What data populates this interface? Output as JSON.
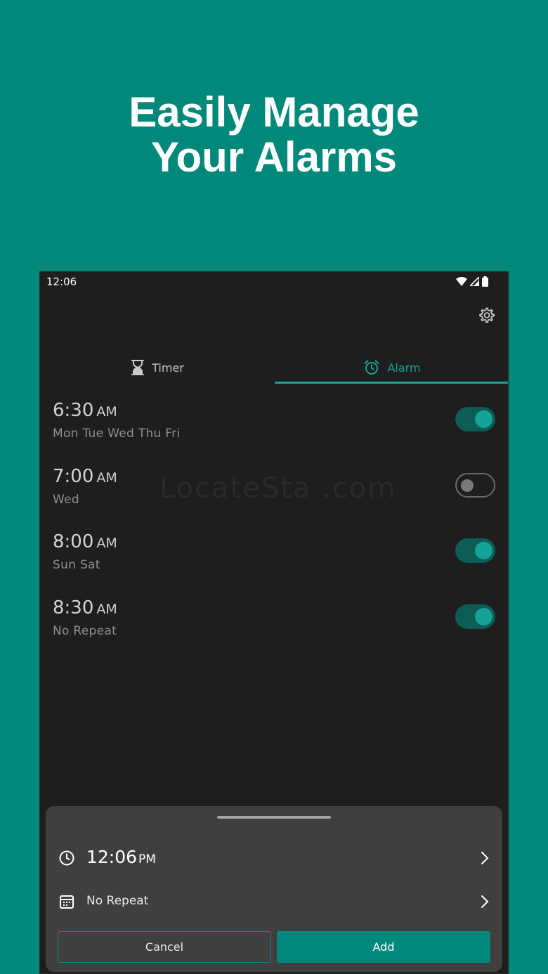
{
  "headline": {
    "line1": "Easily Manage",
    "line2": "Your Alarms"
  },
  "status_bar": {
    "time": "12:06",
    "icons": [
      "wifi-icon",
      "signal-icon",
      "battery-icon"
    ]
  },
  "tabs": [
    {
      "label": "Timer",
      "icon": "hourglass-icon",
      "selected": false
    },
    {
      "label": "Alarm",
      "icon": "alarm-clock-icon",
      "selected": true
    }
  ],
  "alarms": [
    {
      "time": "6:30",
      "ampm": "AM",
      "days": "Mon Tue Wed Thu Fri",
      "enabled": true
    },
    {
      "time": "7:00",
      "ampm": "AM",
      "days": "Wed",
      "enabled": false
    },
    {
      "time": "8:00",
      "ampm": "AM",
      "days": "Sun Sat",
      "enabled": true
    },
    {
      "time": "8:30",
      "ampm": "AM",
      "days": "No Repeat",
      "enabled": true
    }
  ],
  "watermark": "LocateSta .com",
  "sheet": {
    "time": "12:06",
    "ampm": "PM",
    "repeat": "No Repeat",
    "cancel_label": "Cancel",
    "add_label": "Add"
  },
  "colors": {
    "accent": "#14a394",
    "brand_bg": "#00897b",
    "surface": "#1e1e1e",
    "sheet": "#3f3f3f"
  }
}
